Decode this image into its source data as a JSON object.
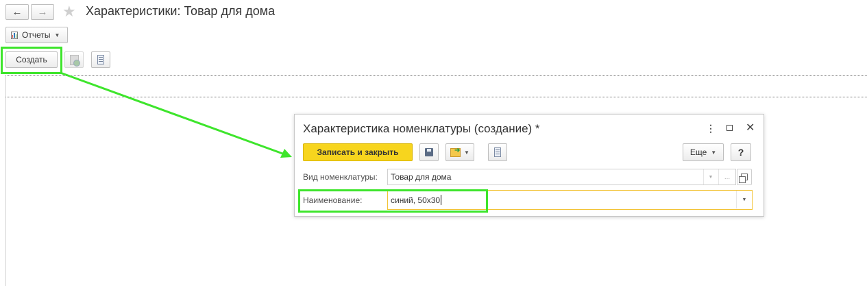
{
  "window": {
    "title": "Характеристики: Товар для дома",
    "back_icon": "arrow-left",
    "forward_icon": "arrow-right",
    "favorite_icon": "star"
  },
  "toolbar": {
    "reports_label": "Отчеты",
    "create_label": "Создать",
    "copy_icon": "copy-document",
    "list_icon": "list-settings"
  },
  "dialog": {
    "title": "Характеристика номенклатуры (создание) *",
    "save_close_label": "Записать и закрыть",
    "more_label": "Еще",
    "help_label": "?",
    "kind_label": "Вид номенклатуры:",
    "kind_value": "Товар для дома",
    "kind_more": "...",
    "name_label": "Наименование:",
    "name_value": "синий, 50х30"
  },
  "colors": {
    "accent_yellow": "#f7d51e",
    "highlight_green": "#3ee52c",
    "active_field_border": "#f2c335"
  }
}
